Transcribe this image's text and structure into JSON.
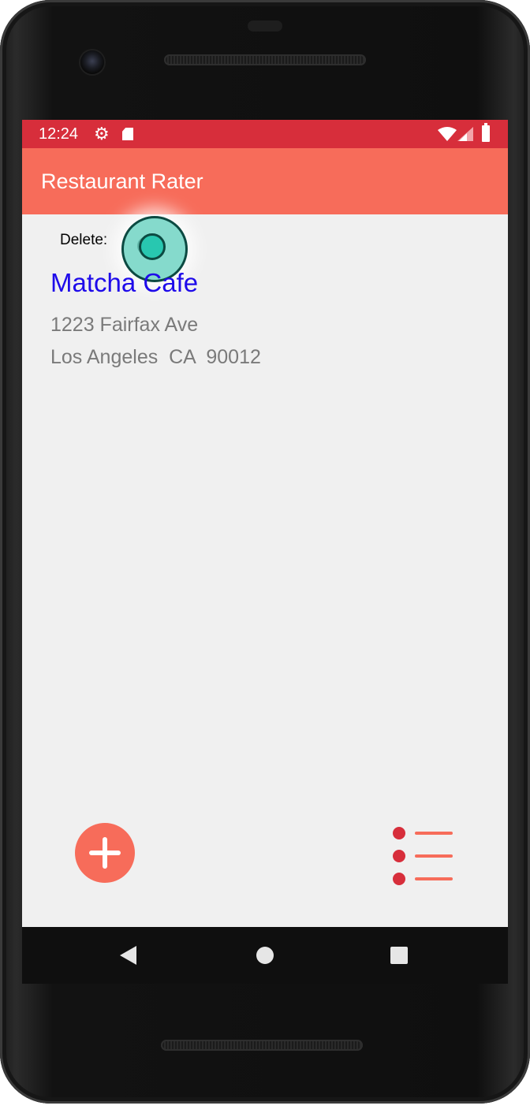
{
  "status_bar": {
    "time": "12:24",
    "icons": [
      "settings-icon",
      "sd-card-icon",
      "wifi-icon",
      "cell-signal-icon",
      "battery-icon"
    ],
    "background": "#d72e3b"
  },
  "app_bar": {
    "title": "Restaurant Rater",
    "background": "#f76c5a"
  },
  "content": {
    "delete_label": "Delete:",
    "restaurant": {
      "name": "Matcha Cafe",
      "street": "1223 Fairfax Ave",
      "city_line": "Los Angeles  CA  90012"
    }
  },
  "actions": {
    "add_icon": "plus-icon",
    "list_icon": "list-icon"
  },
  "nav_bar": {
    "icons": [
      "back-icon",
      "home-icon",
      "recents-icon"
    ]
  },
  "colors": {
    "accent": "#f76c5a",
    "primary_dark": "#d72e3b",
    "link": "#1e0aea",
    "secondary_text": "#7a7a7a",
    "background": "#f0f0f0"
  }
}
